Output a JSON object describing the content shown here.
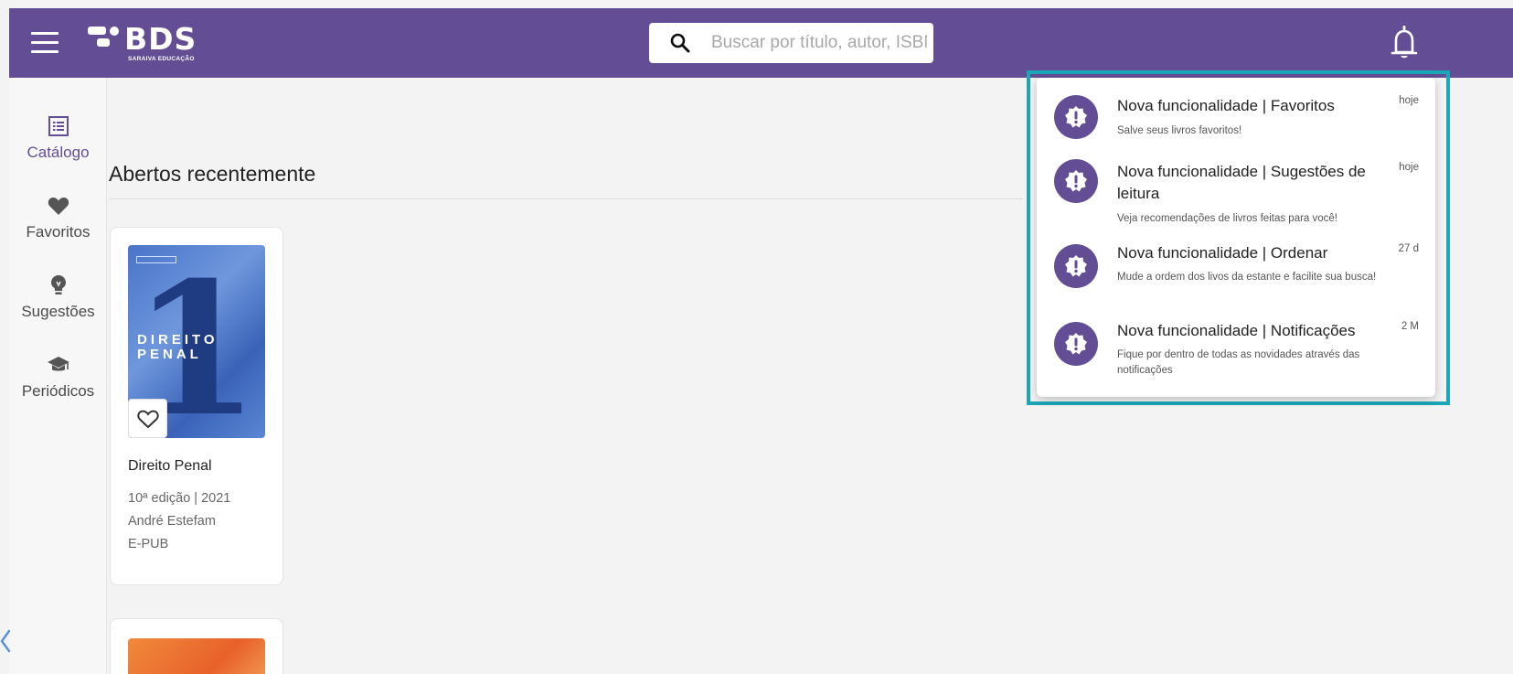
{
  "header": {
    "logo_text": "BDS",
    "logo_subtitle": "SARAIVA EDUCAÇÃO",
    "search_placeholder": "Buscar por título, autor, ISBN",
    "search_value": ""
  },
  "sidebar": {
    "items": [
      {
        "label": "Catálogo",
        "icon": "catalog-icon",
        "active": true
      },
      {
        "label": "Favoritos",
        "icon": "heart-icon",
        "active": false
      },
      {
        "label": "Sugestões",
        "icon": "lightbulb-icon",
        "active": false
      },
      {
        "label": "Periódicos",
        "icon": "graduation-cap-icon",
        "active": false
      }
    ]
  },
  "main": {
    "section_title": "Abertos recentemente",
    "books": [
      {
        "title": "Direito Penal",
        "edition": "10ª edição | 2021",
        "author": "André Estefam",
        "format": "E-PUB",
        "cover_title": "DIREITO PENAL",
        "cover_number": "1"
      }
    ]
  },
  "notifications": [
    {
      "title": "Nova funcionalidade | Favoritos",
      "description": "Salve seus livros favoritos!",
      "time": "hoje"
    },
    {
      "title": "Nova funcionalidade | Sugestões de leitura",
      "description": "Veja recomendações de livros feitas para você!",
      "time": "hoje"
    },
    {
      "title": "Nova funcionalidade | Ordenar",
      "description": "Mude a ordem dos livos da estante e facilite sua busca!",
      "time": "27 d"
    },
    {
      "title": "Nova funcionalidade | Notificações",
      "description": "Fique por dentro de todas as novidades através das notificações",
      "time": "2 M"
    }
  ],
  "colors": {
    "brand": "#634e95",
    "highlight": "#1aa7b8",
    "background": "#f3f3f3"
  }
}
